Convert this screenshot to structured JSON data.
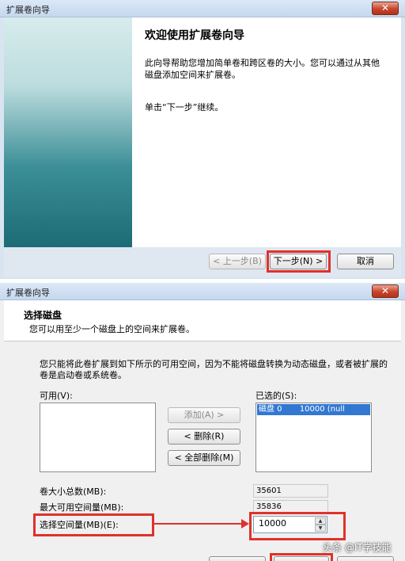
{
  "window1": {
    "title": "扩展卷向导",
    "close_symbol": "✕",
    "heading": "欢迎使用扩展卷向导",
    "paragraph": "此向导帮助您增加简单卷和跨区卷的大小。您可以通过从其他磁盘添加空间来扩展卷。",
    "continue_text": "单击“下一步”继续。",
    "back_button": "< 上一步(B)",
    "next_button": "下一步(N) >",
    "cancel_button": "取消"
  },
  "window2": {
    "title": "扩展卷向导",
    "close_symbol": "✕",
    "heading": "选择磁盘",
    "subheading": "您可以用至少一个磁盘上的空间来扩展卷。",
    "description": "您只能将此卷扩展到如下所示的可用空间，因为不能将磁盘转换为动态磁盘，或者被扩展的卷是启动卷或系统卷。",
    "available_label": "可用(V):",
    "selected_label": "已选的(S):",
    "selected_items": [
      {
        "name": "磁盘 0",
        "size": "10000 (null"
      }
    ],
    "add_button": "添加(A) >",
    "remove_button": "< 删除(R)",
    "remove_all_button": "< 全部删除(M)",
    "total_size_label": "卷大小总数(MB):",
    "total_size_value": "35601",
    "max_space_label": "最大可用空间量(MB):",
    "max_space_value": "35836",
    "select_space_label": "选择空间量(MB)(E):",
    "select_space_value": "10000",
    "spin_up": "▲",
    "spin_down": "▼"
  },
  "watermark": "头条 @IT学技能",
  "colors": {
    "highlight_box": "#e0312a",
    "selection": "#3278d2",
    "title_bar": "#c6d8ee"
  }
}
